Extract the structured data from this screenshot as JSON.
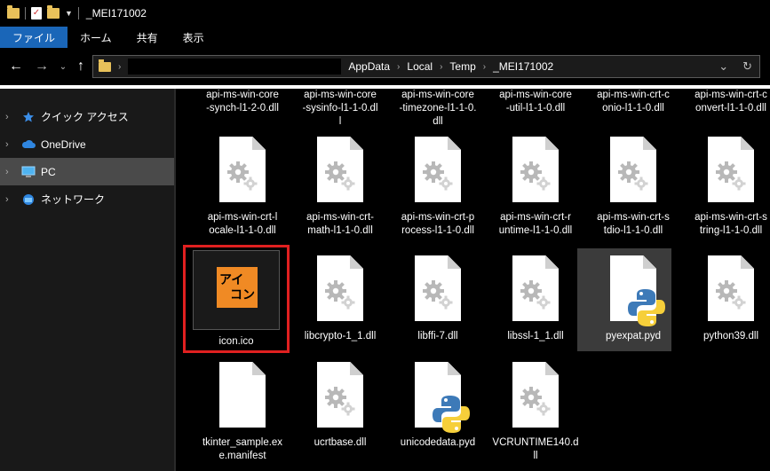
{
  "window": {
    "title": "_MEI171002"
  },
  "ribbon": {
    "tabs": [
      "ファイル",
      "ホーム",
      "共有",
      "表示"
    ],
    "active_tab": "ファイル"
  },
  "address": {
    "crumbs": [
      "AppData",
      "Local",
      "Temp",
      "_MEI171002"
    ]
  },
  "sidebar": {
    "items": [
      {
        "label": "クイック アクセス",
        "icon": "star-icon"
      },
      {
        "label": "OneDrive",
        "icon": "cloud-icon"
      },
      {
        "label": "PC",
        "icon": "pc-icon",
        "selected": true
      },
      {
        "label": "ネットワーク",
        "icon": "network-icon"
      }
    ]
  },
  "files": {
    "row0": [
      "api-ms-win-core-synch-l1-2-0.dll",
      "api-ms-win-core-sysinfo-l1-1-0.dll",
      "api-ms-win-core-timezone-l1-1-0.dll",
      "api-ms-win-core-util-l1-1-0.dll",
      "api-ms-win-crt-conio-l1-1-0.dll",
      "api-ms-win-crt-convert-l1-1-0.dll"
    ],
    "row0_lines": [
      [
        "api-ms-win-core",
        "-synch-l1-2-0.dll"
      ],
      [
        "api-ms-win-core",
        "-sysinfo-l1-1-0.dl",
        "l"
      ],
      [
        "api-ms-win-core",
        "-timezone-l1-1-0.",
        "dll"
      ],
      [
        "api-ms-win-core",
        "-util-l1-1-0.dll"
      ],
      [
        "api-ms-win-crt-c",
        "onio-l1-1-0.dll"
      ],
      [
        "api-ms-win-crt-c",
        "onvert-l1-1-0.dll"
      ]
    ],
    "row1_lines": [
      [
        "api-ms-win-crt-l",
        "ocale-l1-1-0.dll"
      ],
      [
        "api-ms-win-crt-",
        "math-l1-1-0.dll"
      ],
      [
        "api-ms-win-crt-p",
        "rocess-l1-1-0.dll"
      ],
      [
        "api-ms-win-crt-r",
        "untime-l1-1-0.dll"
      ],
      [
        "api-ms-win-crt-s",
        "tdio-l1-1-0.dll"
      ],
      [
        "api-ms-win-crt-s",
        "tring-l1-1-0.dll"
      ]
    ],
    "row2_lines": [
      [
        "icon.ico"
      ],
      [
        "libcrypto-1_1.dll"
      ],
      [
        "libffi-7.dll"
      ],
      [
        "libssl-1_1.dll"
      ],
      [
        "pyexpat.pyd"
      ],
      [
        "python39.dll"
      ]
    ],
    "row3_lines": [
      [
        "tkinter_sample.ex",
        "e.manifest"
      ],
      [
        "ucrtbase.dll"
      ],
      [
        "unicodedata.pyd"
      ],
      [
        "VCRUNTIME140.d",
        "ll"
      ]
    ],
    "icon_ico_text": [
      "アイ",
      "コン"
    ]
  },
  "colors": {
    "accent": "#1a66b8",
    "highlight_box": "#e02020",
    "icon_orange": "#f08a24"
  }
}
